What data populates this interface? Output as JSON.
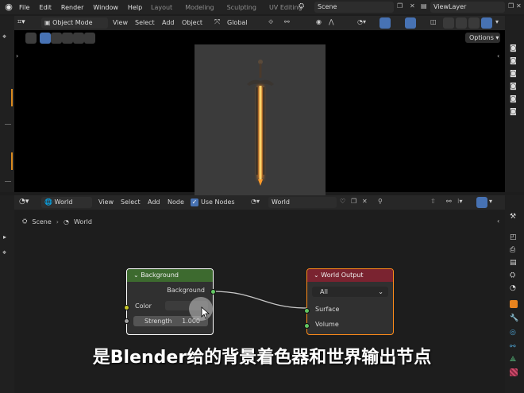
{
  "menu": {
    "items": [
      "File",
      "Edit",
      "Render",
      "Window",
      "Help"
    ]
  },
  "workspaces": {
    "tabs": [
      "Layout",
      "Modeling",
      "Sculpting",
      "UV Editing"
    ]
  },
  "scene_field": "Scene",
  "viewlayer_field": "ViewLayer",
  "viewport": {
    "mode": "Object Mode",
    "menus": [
      "View",
      "Select",
      "Add",
      "Object"
    ],
    "transform": "Global",
    "options": "Options"
  },
  "node_editor": {
    "type": "World",
    "menus": [
      "View",
      "Select",
      "Add",
      "Node"
    ],
    "use_nodes": "Use Nodes",
    "world_name": "World",
    "breadcrumb": [
      "Scene",
      "World"
    ]
  },
  "nodes": {
    "background": {
      "title": "Background",
      "output": "Background",
      "color_label": "Color",
      "strength_label": "Strength",
      "strength_value": "1.000",
      "header_color": "#3d6a2f"
    },
    "world_output": {
      "title": "World Output",
      "target": "All",
      "surface": "Surface",
      "volume": "Volume",
      "header_color": "#7a2330"
    }
  },
  "subtitle": "是Blender给的背景着色器和世界输出节点",
  "colors": {
    "socket_shader": "#63c763",
    "socket_color": "#c7c729",
    "socket_float": "#a1a1a1",
    "selected_outline": "#ffffff",
    "active_outline": "#ff8c19"
  }
}
